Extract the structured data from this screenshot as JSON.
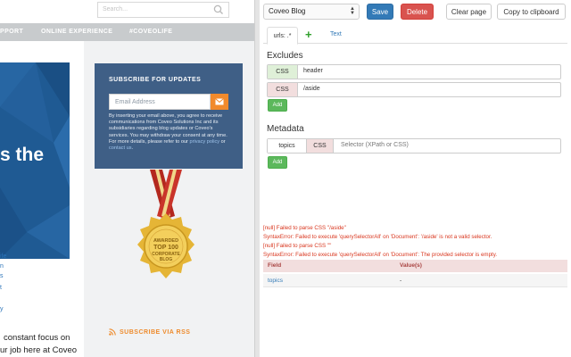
{
  "website": {
    "search_placeholder": "Search...",
    "nav": [
      "PPORT",
      "ONLINE EXPERIENCE",
      "#COVEOLIFE"
    ],
    "hero_text": "s the",
    "side_links": [
      "ife",
      "n",
      "s",
      "t",
      "y"
    ],
    "body_lines": [
      "constant focus on",
      "ur job here at Coveo"
    ],
    "subscribe": {
      "title": "SUBSCRIBE FOR UPDATES",
      "email_placeholder": "Email Address",
      "desc_before": "By inserting your email above, you agree to receive communications from Coveo Solutions Inc and its subsidiaries regarding blog updates or Coveo's services. You may withdraw your consent at any time. For more details, please refer to our ",
      "privacy_link": "privacy policy",
      "desc_or": " or ",
      "contact_link": "contact us",
      "desc_end": "."
    },
    "badge": {
      "line1": "AWARDED",
      "line2": "TOP 100",
      "line3": "CORPORATE",
      "line4": "BLOG"
    },
    "rss": "SUBSCRIBE VIA RSS"
  },
  "extension": {
    "site_select": "Coveo Blog",
    "save": "Save",
    "delete": "Delete",
    "clear": "Clear page",
    "copy": "Copy to clipboard",
    "tab_active": "urls: .*",
    "tab_plus": "+",
    "tab_text": "Text",
    "excludes_title": "Excludes",
    "excludes": [
      {
        "type": "CSS",
        "value": "header"
      },
      {
        "type": "CSS",
        "value": "/aside"
      }
    ],
    "add_label": "Add",
    "metadata_title": "Metadata",
    "metadata": [
      {
        "name": "topics",
        "type": "CSS",
        "placeholder": "Selector (XPath or CSS)"
      }
    ],
    "errors": [
      "[null] Failed to parse CSS \"/aside\"",
      "SyntaxError: Failed to execute 'querySelectorAll' on 'Document': '/aside' is not a valid selector.",
      "[null] Failed to parse CSS \"\"",
      "SyntaxError: Failed to execute 'querySelectorAll' on 'Document': The provided selector is empty."
    ],
    "results": {
      "headers": [
        "Field",
        "Value(s)"
      ],
      "rows": [
        [
          "topics",
          "-"
        ]
      ]
    }
  },
  "colors": {
    "primary": "#337ab7",
    "danger": "#d9534f",
    "success": "#5cb85c",
    "site_blue": "#1f5a93",
    "subscribe_bg": "#3f5f86",
    "accent_orange": "#f18a2c"
  }
}
